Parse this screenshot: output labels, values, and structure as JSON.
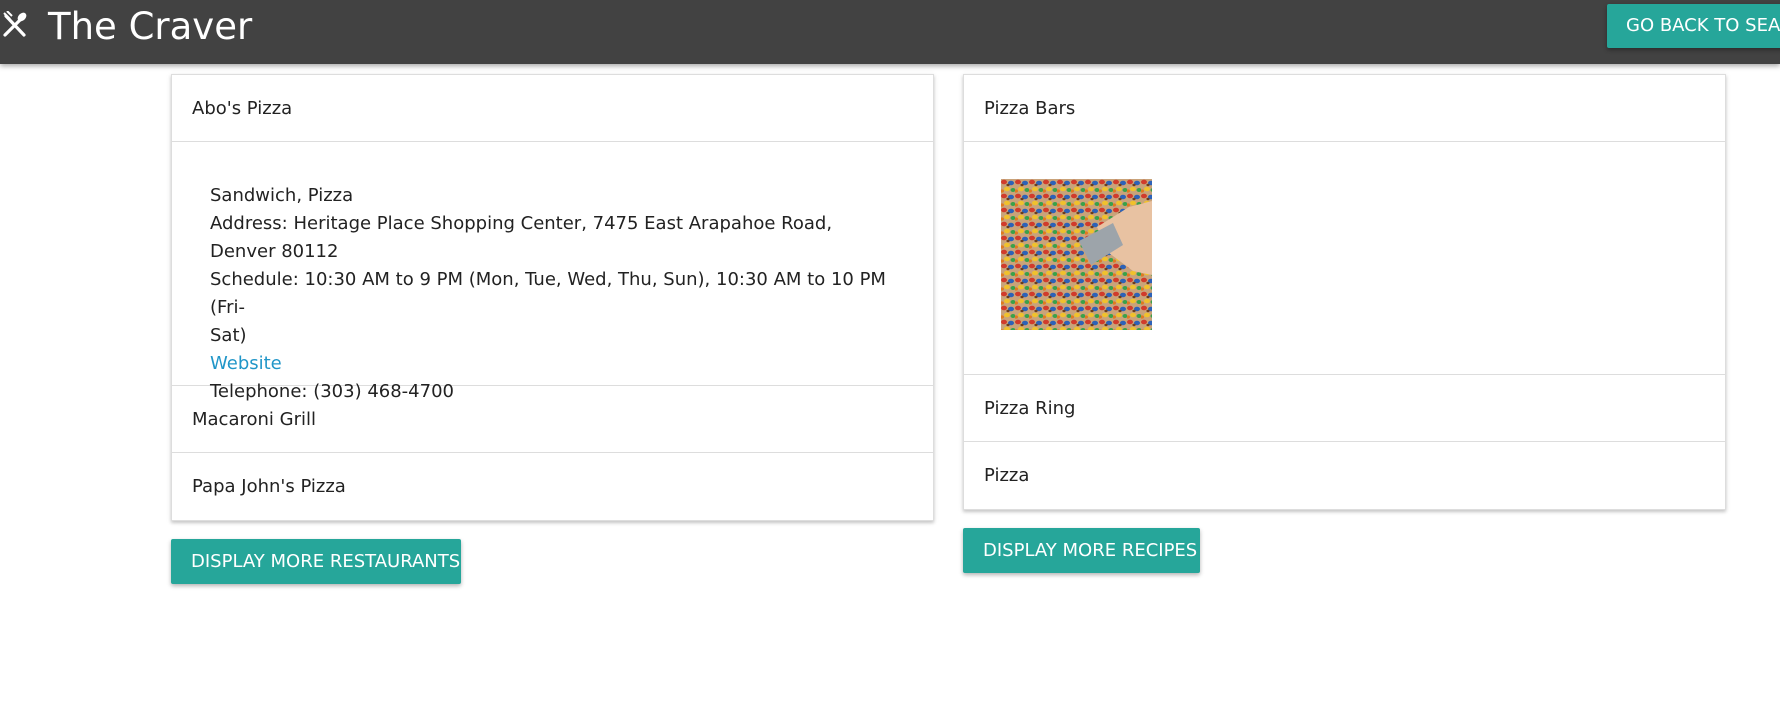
{
  "navbar": {
    "title": "The Craver",
    "icon": "fork-knife-icon",
    "back_button_label": "GO BACK TO SEARCH"
  },
  "restaurants": {
    "items": [
      {
        "name": "Abo's Pizza",
        "expanded": true,
        "categories": "Sandwich, Pizza",
        "address": "Address: Heritage Place Shopping Center, 7475 East Arapahoe Road, Denver 80112",
        "schedule_line1": "Schedule: 10:30 AM to 9 PM (Mon, Tue, Wed, Thu, Sun), 10:30 AM to 10 PM (Fri-",
        "schedule_line2": "Sat)",
        "website_label": "Website",
        "telephone": "Telephone: (303) 468-4700"
      },
      {
        "name": "Macaroni Grill"
      },
      {
        "name": "Papa John's Pizza"
      }
    ],
    "more_button_label": "DISPLAY MORE RESTAURANTS"
  },
  "recipes": {
    "items": [
      {
        "name": "Pizza Bars",
        "expanded": true,
        "image": "candy-pizza-bars-photo"
      },
      {
        "name": "Pizza Ring"
      },
      {
        "name": "Pizza"
      }
    ],
    "more_button_label": "DISPLAY MORE RECIPES"
  },
  "colors": {
    "navbar": "#424242",
    "accent": "#26a69a",
    "link": "#2196c8"
  }
}
